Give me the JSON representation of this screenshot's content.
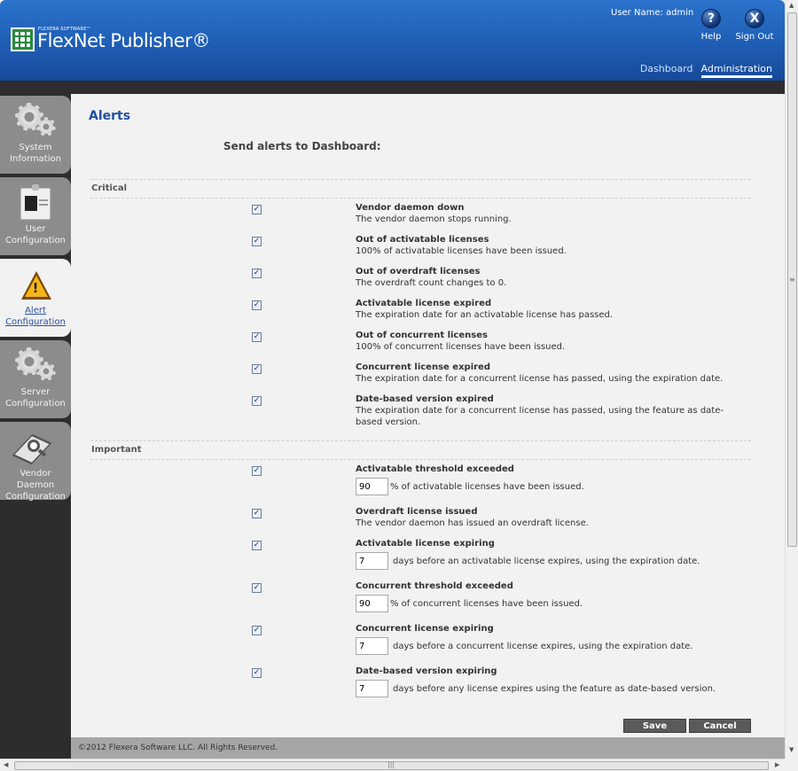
{
  "header": {
    "logo_company": "FLEXERA SOFTWARE™",
    "logo_product": "FlexNet Publisher®",
    "username": "User Name: admin",
    "help_glyph": "?",
    "help_label": "Help",
    "signout_glyph": "X",
    "signout_label": "Sign Out",
    "tabs": [
      {
        "label": "Dashboard",
        "active": false
      },
      {
        "label": "Administration",
        "active": true
      }
    ]
  },
  "sidebar": {
    "items": [
      {
        "label_1": "System",
        "label_2": "Information",
        "icon": "gears-icon",
        "active": false
      },
      {
        "label_1": "User",
        "label_2": "Configuration",
        "icon": "id-badge-icon",
        "active": false
      },
      {
        "label_1": "Alert",
        "label_2": "Configuration",
        "icon": "warning-icon",
        "active": true
      },
      {
        "label_1": "Server",
        "label_2": "Configuration",
        "icon": "gears-icon",
        "active": false
      },
      {
        "label_1": "Vendor Daemon",
        "label_2": "Configuration",
        "icon": "magnifier-icon",
        "active": false
      }
    ]
  },
  "main": {
    "title": "Alerts",
    "send_alerts_label": "Send alerts to Dashboard:",
    "critical": {
      "header": "Critical",
      "items": [
        {
          "title": "Vendor daemon down",
          "desc": "The vendor daemon stops running.",
          "checked": true
        },
        {
          "title": "Out of activatable licenses",
          "desc": "100% of activatable licenses have been issued.",
          "checked": true
        },
        {
          "title": "Out of overdraft licenses",
          "desc": "The overdraft count changes to 0.",
          "checked": true
        },
        {
          "title": "Activatable license expired",
          "desc": "The expiration date for an activatable license has passed.",
          "checked": true
        },
        {
          "title": "Out of concurrent licenses",
          "desc": "100% of concurrent licenses have been issued.",
          "checked": true
        },
        {
          "title": "Concurrent license expired",
          "desc": "The expiration date for a concurrent license has passed, using the expiration date.",
          "checked": true
        },
        {
          "title": "Date-based version expired",
          "desc": "The expiration date for a concurrent license has passed, using the feature as date-based version.",
          "checked": true
        }
      ]
    },
    "important": {
      "header": "Important",
      "items": [
        {
          "title": "Activatable threshold exceeded",
          "value": "90",
          "suffix": "% of activatable licenses have been issued.",
          "checked": true
        },
        {
          "title": "Overdraft license issued",
          "desc": "The vendor daemon has issued an overdraft license.",
          "checked": true
        },
        {
          "title": "Activatable license expiring",
          "value": "7",
          "suffix": "days before an activatable license expires, using the expiration date.",
          "checked": true
        },
        {
          "title": "Concurrent threshold exceeded",
          "value": "90",
          "suffix": "% of concurrent licenses have been issued.",
          "checked": true
        },
        {
          "title": "Concurrent license expiring",
          "value": "7",
          "suffix": "days before a concurrent license expires, using the expiration date.",
          "checked": true
        },
        {
          "title": "Date-based version expiring",
          "value": "7",
          "suffix": "days before any license expires using the feature as date-based version.",
          "checked": true
        }
      ]
    },
    "checkmark": "✓",
    "save_label": "Save",
    "cancel_label": "Cancel"
  },
  "footer": {
    "copyright": "©2012 Flexera Software LLC. All Rights Reserved."
  },
  "scrollbars": {
    "up": "▲",
    "down": "▼",
    "left": "◀",
    "right": "▶",
    "grip_v": "≡",
    "grip_h": "|||"
  },
  "colors": {
    "header_blue": "#1f5eb5",
    "title_blue": "#1f4f9e",
    "sidebar_dark": "#2d2d2d",
    "sidebar_tab": "#8c8c8c",
    "content_bg": "#f2f2f2",
    "button_gray": "#5a5a5a"
  }
}
